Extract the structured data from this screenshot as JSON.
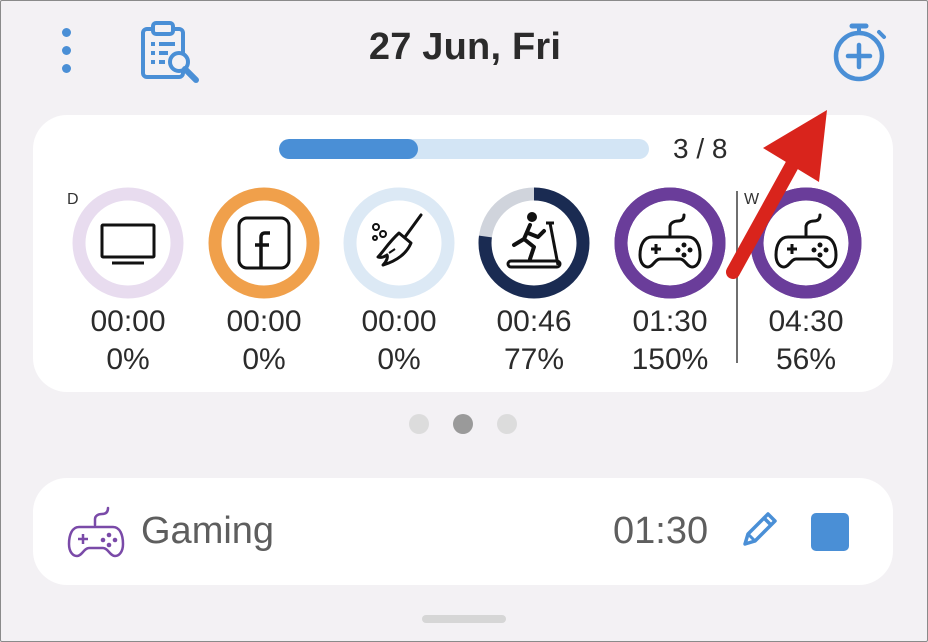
{
  "header": {
    "date_title": "27 Jun, Fri",
    "menu_icon": "kebab-menu-icon",
    "clipboard_icon": "clipboard-search-icon",
    "add_timer_icon": "add-timer-icon"
  },
  "summary": {
    "progress": {
      "completed": 3,
      "total": 8,
      "label": "3 / 8"
    },
    "daily_label": "D",
    "weekly_label": "W",
    "items": [
      {
        "icon": "tv-icon",
        "time": "00:00",
        "percent": "0%",
        "progress": 0.0,
        "ring_color": "#e8dcef",
        "track_color": "#e8dcef"
      },
      {
        "icon": "facebook-icon",
        "time": "00:00",
        "percent": "0%",
        "progress": 0.0,
        "ring_color": "#f0a04b",
        "track_color": "#f0a04b"
      },
      {
        "icon": "broom-icon",
        "time": "00:00",
        "percent": "0%",
        "progress": 0.0,
        "ring_color": "#dce9f5",
        "track_color": "#dce9f5"
      },
      {
        "icon": "treadmill-icon",
        "time": "00:46",
        "percent": "77%",
        "progress": 0.77,
        "ring_color": "#1a2b52",
        "track_color": "#d0d4dc"
      },
      {
        "icon": "gamepad-icon",
        "time": "01:30",
        "percent": "150%",
        "progress": 1.0,
        "ring_color": "#6a3d9a",
        "track_color": "#6a3d9a"
      },
      {
        "icon": "gamepad-icon",
        "time": "04:30",
        "percent": "56%",
        "progress": 1.0,
        "ring_color": "#6a3d9a",
        "track_color": "#6a3d9a"
      }
    ]
  },
  "pager": {
    "count": 3,
    "active_index": 1
  },
  "active_activity": {
    "icon": "gamepad-icon",
    "label": "Gaming",
    "time": "01:30",
    "edit_icon": "pencil-icon",
    "stop_icon": "stop-icon"
  },
  "colors": {
    "accent": "#4a8fd6",
    "background": "#f3f1f4",
    "gaming": "#6a3d9a",
    "annotation_arrow": "#d9241c"
  }
}
